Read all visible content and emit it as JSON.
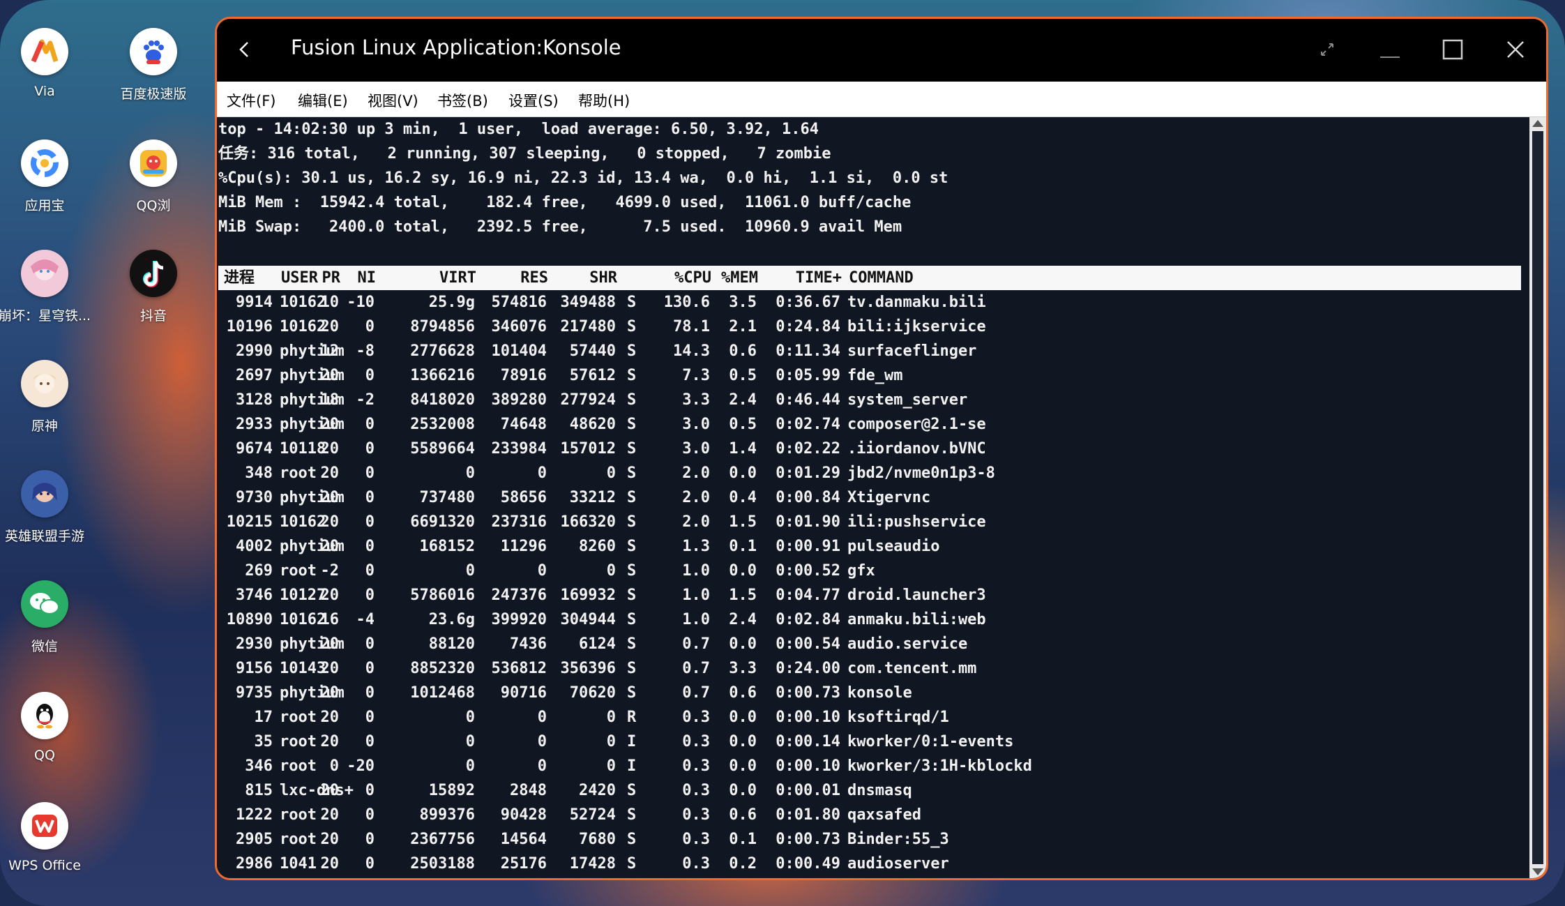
{
  "dock": {
    "apps": [
      {
        "name": "app-via",
        "label": "Via",
        "color": "#ffffff"
      },
      {
        "name": "app-baidu",
        "label": "百度极速版",
        "color": "#ffffff"
      },
      {
        "name": "app-yingyongbao",
        "label": "应用宝",
        "color": "#ffffff"
      },
      {
        "name": "app-qqbrowser",
        "label": "QQ浏",
        "color": "#ffffff"
      },
      {
        "name": "app-starrail",
        "label": "崩坏：星穹铁...",
        "color": "#f2c9d8"
      },
      {
        "name": "app-douyin",
        "label": "抖音",
        "color": "#111111"
      },
      {
        "name": "app-genshin",
        "label": "原神",
        "color": "#f5e6d6"
      },
      {
        "name": "app-lol",
        "label": "英雄联盟手游",
        "color": "#3b5fa8"
      },
      {
        "name": "app-wechat",
        "label": "微信",
        "color": "#2aae67"
      },
      {
        "name": "app-qq",
        "label": "QQ",
        "color": "#ffffff"
      },
      {
        "name": "app-wps",
        "label": "WPS Office",
        "color": "#ffffff"
      }
    ]
  },
  "window": {
    "title": "Fusion Linux Application:Konsole",
    "menu": [
      "文件(F)",
      "编辑(E)",
      "视图(V)",
      "书签(B)",
      "设置(S)",
      "帮助(H)"
    ]
  },
  "terminal": {
    "summary": [
      "top - 14:02:30 up 3 min,  1 user,  load average: 6.50, 3.92, 1.64",
      "任务: 316 total,   2 running, 307 sleeping,   0 stopped,   7 zombie",
      "%Cpu(s): 30.1 us, 16.2 sy, 16.9 ni, 22.3 id, 13.4 wa,  0.0 hi,  1.1 si,  0.0 st",
      "MiB Mem :  15942.4 total,    182.4 free,   4699.0 used,  11061.0 buff/cache",
      "MiB Swap:   2400.0 total,   2392.5 free,      7.5 used.  10960.9 avail Mem"
    ],
    "columns": [
      "进程",
      "USER",
      "PR",
      "NI",
      "VIRT",
      "RES",
      "SHR",
      "",
      "%CPU",
      "%MEM",
      "TIME+",
      "COMMAND"
    ],
    "rows": [
      [
        "9914",
        "10162",
        "10",
        "-10",
        "25.9g",
        "574816",
        "349488",
        "S",
        "130.6",
        "3.5",
        "0:36.67",
        "tv.danmaku.bili"
      ],
      [
        "10196",
        "10162",
        "20",
        "0",
        "8794856",
        "346076",
        "217480",
        "S",
        "78.1",
        "2.1",
        "0:24.84",
        "bili:ijkservice"
      ],
      [
        "2990",
        "phytium",
        "12",
        "-8",
        "2776628",
        "101404",
        "57440",
        "S",
        "14.3",
        "0.6",
        "0:11.34",
        "surfaceflinger"
      ],
      [
        "2697",
        "phytium",
        "20",
        "0",
        "1366216",
        "78916",
        "57612",
        "S",
        "7.3",
        "0.5",
        "0:05.99",
        "fde_wm"
      ],
      [
        "3128",
        "phytium",
        "18",
        "-2",
        "8418020",
        "389280",
        "277924",
        "S",
        "3.3",
        "2.4",
        "0:46.44",
        "system_server"
      ],
      [
        "2933",
        "phytium",
        "20",
        "0",
        "2532008",
        "74648",
        "48620",
        "S",
        "3.0",
        "0.5",
        "0:02.74",
        "composer@2.1-se"
      ],
      [
        "9674",
        "10118",
        "20",
        "0",
        "5589664",
        "233984",
        "157012",
        "S",
        "3.0",
        "1.4",
        "0:02.22",
        ".iiordanov.bVNC"
      ],
      [
        "348",
        "root",
        "20",
        "0",
        "0",
        "0",
        "0",
        "S",
        "2.0",
        "0.0",
        "0:01.29",
        "jbd2/nvme0n1p3-8"
      ],
      [
        "9730",
        "phytium",
        "20",
        "0",
        "737480",
        "58656",
        "33212",
        "S",
        "2.0",
        "0.4",
        "0:00.84",
        "Xtigervnc"
      ],
      [
        "10215",
        "10162",
        "20",
        "0",
        "6691320",
        "237316",
        "166320",
        "S",
        "2.0",
        "1.5",
        "0:01.90",
        "ili:pushservice"
      ],
      [
        "4002",
        "phytium",
        "20",
        "0",
        "168152",
        "11296",
        "8260",
        "S",
        "1.3",
        "0.1",
        "0:00.91",
        "pulseaudio"
      ],
      [
        "269",
        "root",
        "-2",
        "0",
        "0",
        "0",
        "0",
        "S",
        "1.0",
        "0.0",
        "0:00.52",
        "gfx"
      ],
      [
        "3746",
        "10127",
        "20",
        "0",
        "5786016",
        "247376",
        "169932",
        "S",
        "1.0",
        "1.5",
        "0:04.77",
        "droid.launcher3"
      ],
      [
        "10890",
        "10162",
        "16",
        "-4",
        "23.6g",
        "399920",
        "304944",
        "S",
        "1.0",
        "2.4",
        "0:02.84",
        "anmaku.bili:web"
      ],
      [
        "2930",
        "phytium",
        "20",
        "0",
        "88120",
        "7436",
        "6124",
        "S",
        "0.7",
        "0.0",
        "0:00.54",
        "audio.service"
      ],
      [
        "9156",
        "10143",
        "20",
        "0",
        "8852320",
        "536812",
        "356396",
        "S",
        "0.7",
        "3.3",
        "0:24.00",
        "com.tencent.mm"
      ],
      [
        "9735",
        "phytium",
        "20",
        "0",
        "1012468",
        "90716",
        "70620",
        "S",
        "0.7",
        "0.6",
        "0:00.73",
        "konsole"
      ],
      [
        "17",
        "root",
        "20",
        "0",
        "0",
        "0",
        "0",
        "R",
        "0.3",
        "0.0",
        "0:00.10",
        "ksoftirqd/1"
      ],
      [
        "35",
        "root",
        "20",
        "0",
        "0",
        "0",
        "0",
        "I",
        "0.3",
        "0.0",
        "0:00.14",
        "kworker/0:1-events"
      ],
      [
        "346",
        "root",
        "0",
        "-20",
        "0",
        "0",
        "0",
        "I",
        "0.3",
        "0.0",
        "0:00.10",
        "kworker/3:1H-kblockd"
      ],
      [
        "815",
        "lxc-dns+",
        "20",
        "0",
        "15892",
        "2848",
        "2420",
        "S",
        "0.3",
        "0.0",
        "0:00.01",
        "dnsmasq"
      ],
      [
        "1222",
        "root",
        "20",
        "0",
        "899376",
        "90428",
        "52724",
        "S",
        "0.3",
        "0.6",
        "0:01.80",
        "qaxsafed"
      ],
      [
        "2905",
        "root",
        "20",
        "0",
        "2367756",
        "14564",
        "7680",
        "S",
        "0.3",
        "0.1",
        "0:00.73",
        "Binder:55_3"
      ],
      [
        "2986",
        "1041",
        "20",
        "0",
        "2503188",
        "25176",
        "17428",
        "S",
        "0.3",
        "0.2",
        "0:00.49",
        "audioserver"
      ]
    ]
  }
}
